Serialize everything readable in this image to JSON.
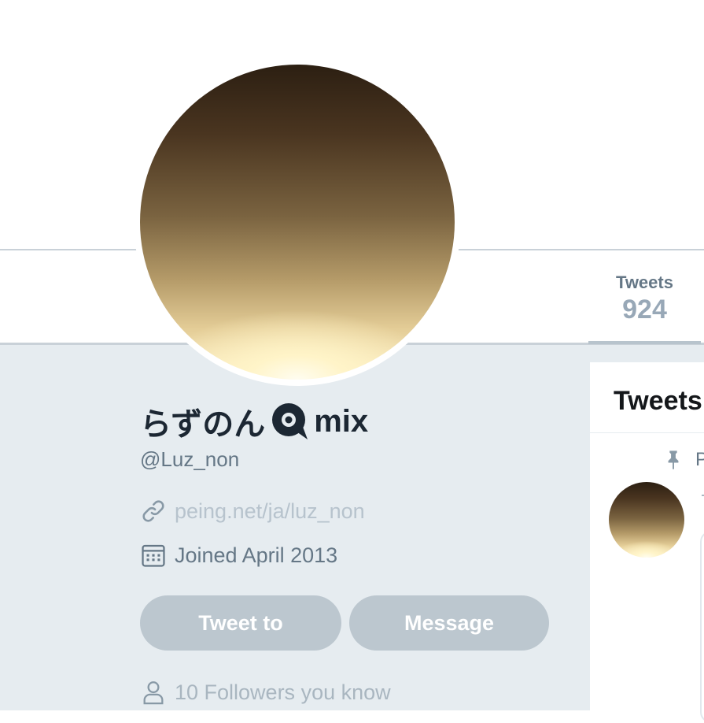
{
  "profile": {
    "display_name": "らずのん",
    "display_name_suffix": "mix",
    "display_name_icon": "speech-bubble-q-icon",
    "handle": "@Luz_non",
    "website": "peing.net/ja/luz_non",
    "joined": "Joined April 2013"
  },
  "nav": {
    "tweets_label": "Tweets",
    "tweets_count": "924"
  },
  "actions": {
    "tweet_to_label": "Tweet to",
    "message_label": "Message"
  },
  "followers_you_know": "10 Followers you know",
  "timeline": {
    "heading": "Tweets",
    "pinned_text": "P"
  },
  "colors": {
    "page_background": "#e6ecf0",
    "button_disabled": "#bcc7cf",
    "text_primary": "#1c2733",
    "text_secondary": "#657786",
    "text_muted": "#b7c3cd"
  }
}
